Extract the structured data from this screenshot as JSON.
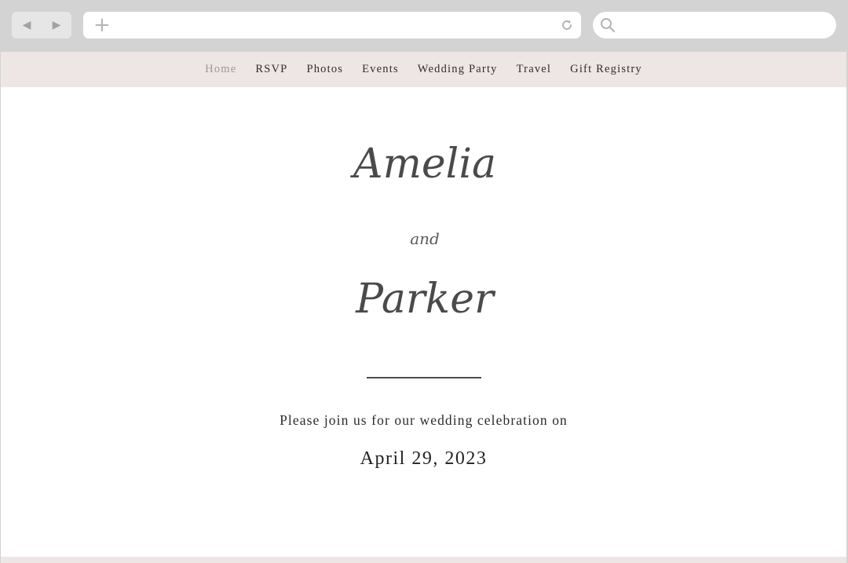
{
  "browser": {
    "back_icon": "back-arrow-icon",
    "forward_icon": "forward-arrow-icon",
    "new_tab_icon": "plus-icon",
    "reload_icon": "reload-icon",
    "search_icon": "search-icon",
    "address_value": "",
    "search_placeholder": ""
  },
  "nav": {
    "items": [
      {
        "label": "Home"
      },
      {
        "label": "RSVP"
      },
      {
        "label": "Photos"
      },
      {
        "label": "Events"
      },
      {
        "label": "Wedding Party"
      },
      {
        "label": "Travel"
      },
      {
        "label": "Gift Registry"
      }
    ],
    "active_index": 0
  },
  "hero": {
    "name_one": "Amelia",
    "conjunction": "and",
    "name_two": "Parker",
    "invite_text": "Please join us for our wedding celebration on",
    "date": "April 29, 2023"
  },
  "colors": {
    "nav_background": "#eee5e5",
    "browser_chrome": "#d3d3d3",
    "active_nav": "#9a9a9a",
    "text": "#2b2b2b"
  }
}
